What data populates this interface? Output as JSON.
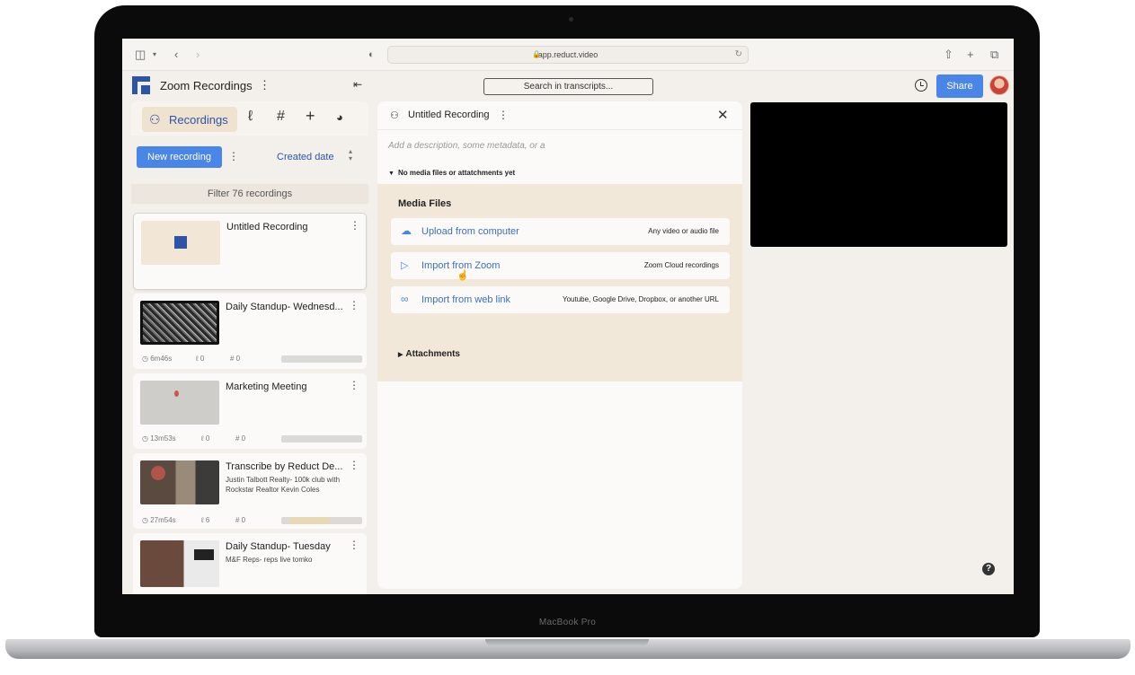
{
  "device": {
    "brand": "MacBook Pro"
  },
  "browser": {
    "url": "app.reduct.video",
    "icons": [
      "sidebar-toggle-icon",
      "chevron-down-icon",
      "back-icon",
      "forward-icon",
      "shield-icon",
      "lock-icon",
      "reload-icon",
      "share-icon",
      "new-tab-icon",
      "tabs-icon"
    ]
  },
  "header": {
    "title": "Zoom Recordings",
    "search_label": "Search in transcripts...",
    "share_label": "Share"
  },
  "sidebar": {
    "tabs": [
      {
        "label": "Recordings",
        "icon": "recordings-icon"
      },
      {
        "label": "",
        "icon": "highlights-icon"
      },
      {
        "label": "",
        "icon": "hashtag-icon"
      },
      {
        "label": "",
        "icon": "add-icon"
      },
      {
        "label": "",
        "icon": "chat-icon"
      }
    ],
    "new_recording_label": "New recording",
    "sort_label": "Created date",
    "filter_label": "Filter 76 recordings",
    "recordings": [
      {
        "title": "Untitled Recording",
        "subtitle": "",
        "duration": "",
        "highlights": "",
        "tags": ""
      },
      {
        "title": "Daily Standup- Wednesd...",
        "subtitle": "",
        "duration": "6m46s",
        "highlights": "0",
        "tags": "0"
      },
      {
        "title": "Marketing Meeting",
        "subtitle": "",
        "duration": "13m53s",
        "highlights": "0",
        "tags": "0"
      },
      {
        "title": "Transcribe by Reduct De...",
        "subtitle": "Justin Talbott Realty- 100k club with Rockstar Realtor Kevin Coles",
        "duration": "27m54s",
        "highlights": "6",
        "tags": "0"
      },
      {
        "title": "Daily Standup- Tuesday",
        "subtitle": "M&F Reps- reps live tomko",
        "duration": "",
        "highlights": "",
        "tags": ""
      }
    ]
  },
  "detail": {
    "title": "Untitled Recording",
    "description_placeholder": "Add a description, some metadata, or a",
    "no_media_label": "No media files or attatchments yet",
    "media_files_heading": "Media Files",
    "options": [
      {
        "label": "Upload from computer",
        "hint": "Any video or audio file",
        "icon": "upload-cloud-icon"
      },
      {
        "label": "Import from Zoom",
        "hint": "Zoom Cloud recordings",
        "icon": "zoom-camera-icon"
      },
      {
        "label": "Import from web link",
        "hint": "Youtube, Google Drive, Dropbox, or another URL",
        "icon": "link-icon"
      }
    ],
    "attachments_label": "Attachments"
  },
  "colors": {
    "accent": "#4a86e8",
    "link": "#3b6fc0",
    "panel_tint": "#f2e8da",
    "background": "#f3efea"
  }
}
